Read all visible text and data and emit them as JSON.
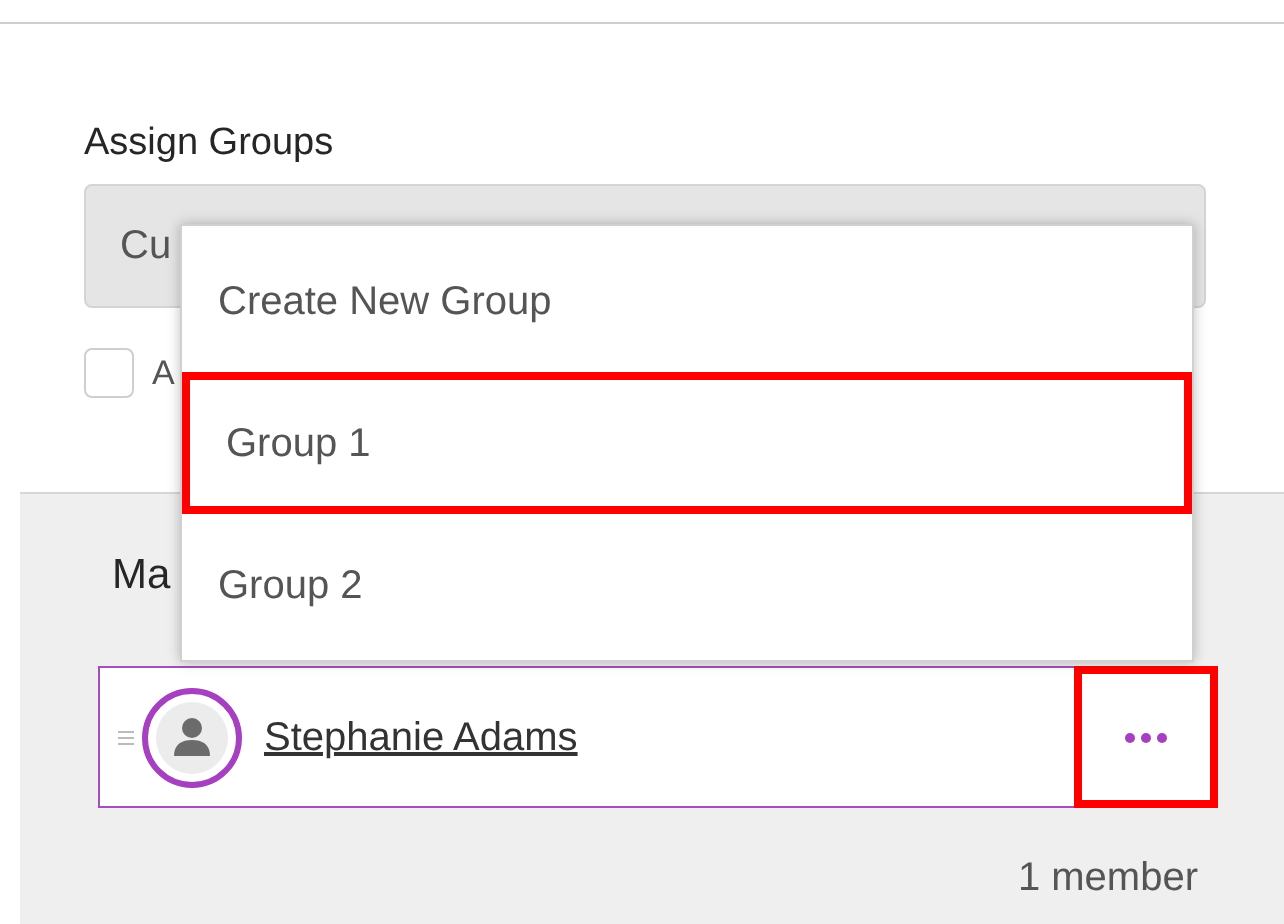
{
  "assign_groups": {
    "label": "Assign Groups",
    "select_value": "Cu",
    "checkbox": {
      "label": "A",
      "checked": false
    }
  },
  "members_panel": {
    "title": "Ma",
    "members": [
      {
        "name": "Stephanie Adams",
        "more_highlighted": true
      }
    ],
    "count": "1 member"
  },
  "menu": {
    "items": [
      {
        "label": "Create New Group",
        "highlighted": false
      },
      {
        "label": "Group 1",
        "highlighted": true
      },
      {
        "label": "Group 2",
        "highlighted": false
      }
    ]
  }
}
